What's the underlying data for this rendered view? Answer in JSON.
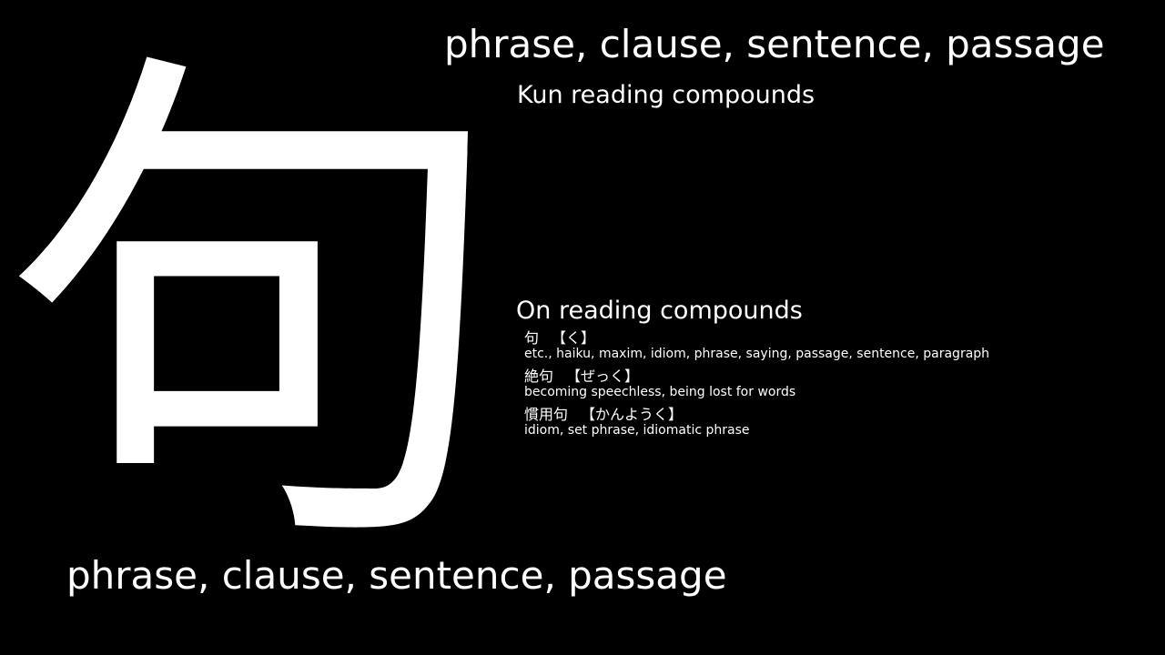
{
  "kanji": {
    "character": "句"
  },
  "meanings": {
    "top": "phrase, clause, sentence, passage",
    "bottom": "phrase, clause, sentence, passage"
  },
  "kun": {
    "heading": "Kun reading compounds"
  },
  "on": {
    "heading": "On reading compounds",
    "compounds": [
      {
        "word": "句",
        "reading": "【く】",
        "gloss": "etc., haiku, maxim, idiom, phrase, saying, passage, sentence, paragraph"
      },
      {
        "word": "絶句",
        "reading": "【ぜっく】",
        "gloss": "becoming speechless, being lost for words"
      },
      {
        "word": "慣用句",
        "reading": "【かんようく】",
        "gloss": "idiom, set phrase, idiomatic phrase"
      }
    ]
  }
}
